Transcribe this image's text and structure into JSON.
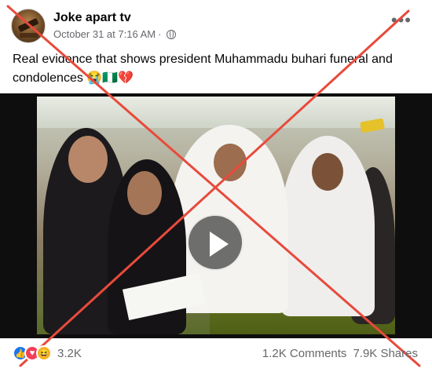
{
  "post": {
    "page_name": "Joke apart tv",
    "timestamp": "October 31 at 7:16 AM",
    "separator": "·",
    "more_label": "•••",
    "caption": "Real evidence that shows president Muhammadu buhari funeral and condolences",
    "caption_emojis": "😭🇳🇬💔"
  },
  "media": {
    "type": "video",
    "play_icon": "play-icon",
    "overlay": "red-cross-mark",
    "overlay_color": "#e84a3c"
  },
  "footer": {
    "reaction_icons": [
      "like-icon",
      "love-icon",
      "haha-icon"
    ],
    "reaction_count": "3.2K",
    "comments": "1.2K Comments",
    "shares": "7.9K Shares"
  },
  "colors": {
    "secondary_text": "#65676b",
    "like_blue": "#1877f2",
    "love_red": "#f33e58",
    "haha_yellow": "#f7b125"
  }
}
